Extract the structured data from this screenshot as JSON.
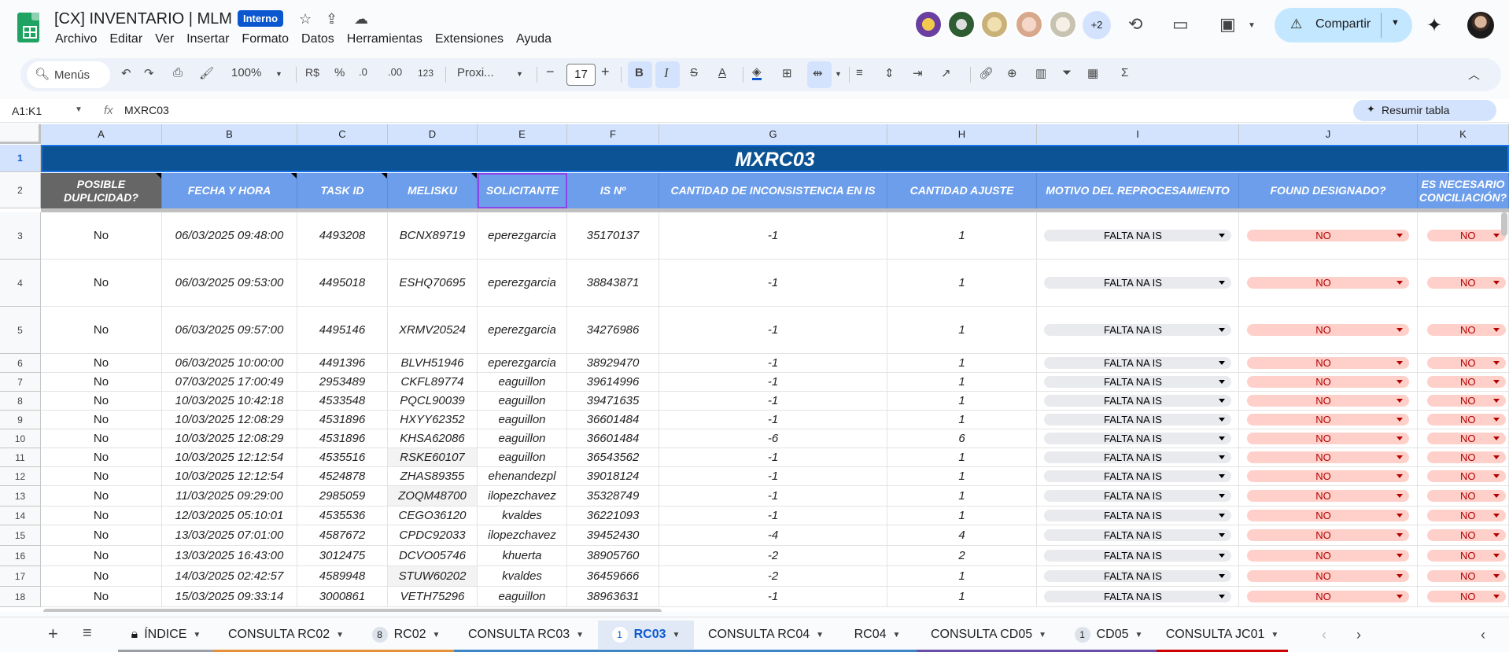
{
  "window": {
    "doc_title": "[CX] INVENTARIO | MLM",
    "badge": "Interno",
    "menu": [
      "Archivo",
      "Editar",
      "Ver",
      "Insertar",
      "Formato",
      "Datos",
      "Herramientas",
      "Extensiones",
      "Ayuda"
    ],
    "extra_collaborators": "+2",
    "share_label": "Compartir"
  },
  "toolbar": {
    "search_label": "Menús",
    "zoom": "100%",
    "currency": "R$",
    "percent": "%",
    "dec_decrease": ".0",
    "dec_increase": ".00",
    "number_format": "123",
    "font": "Proxi...",
    "font_size": "17"
  },
  "formula_bar": {
    "name_box": "A1:K1",
    "formula": "MXRC03",
    "summary_button": "Resumir tabla"
  },
  "grid": {
    "column_letters": [
      "A",
      "B",
      "C",
      "D",
      "E",
      "F",
      "G",
      "H",
      "I",
      "J",
      "K"
    ],
    "banner": "MXRC03",
    "headers": [
      "POSIBLE DUPLICIDAD?",
      "FECHA Y HORA",
      "TASK ID",
      "MELISKU",
      "SOLICITANTE",
      "IS Nº",
      "CANTIDAD DE INCONSISTENCIA EN IS",
      "CANTIDAD AJUSTE",
      "MOTIVO DEL REPROCESAMIENTO",
      "FOUND DESIGNADO?",
      "ES NECESARIO CONCILIACIÓN?"
    ],
    "row_numbers": [
      "1",
      "2",
      "3",
      "4",
      "5",
      "6",
      "7",
      "8",
      "9",
      "10",
      "11",
      "12",
      "13",
      "14",
      "15",
      "16",
      "17",
      "18"
    ],
    "rows": [
      [
        "No",
        "06/03/2025 09:48:00",
        "4493208",
        "BCNX89719",
        "eperezgarcia",
        "35170137",
        "-1",
        "1",
        "FALTA NA IS",
        "NO",
        "NO"
      ],
      [
        "No",
        "06/03/2025 09:53:00",
        "4495018",
        "ESHQ70695",
        "eperezgarcia",
        "38843871",
        "-1",
        "1",
        "FALTA NA IS",
        "NO",
        "NO"
      ],
      [
        "No",
        "06/03/2025 09:57:00",
        "4495146",
        "XRMV20524",
        "eperezgarcia",
        "34276986",
        "-1",
        "1",
        "FALTA NA IS",
        "NO",
        "NO"
      ],
      [
        "No",
        "06/03/2025 10:00:00",
        "4491396",
        "BLVH51946",
        "eperezgarcia",
        "38929470",
        "-1",
        "1",
        "FALTA NA IS",
        "NO",
        "NO"
      ],
      [
        "No",
        "07/03/2025 17:00:49",
        "2953489",
        "CKFL89774",
        "eaguillon",
        "39614996",
        "-1",
        "1",
        "FALTA NA IS",
        "NO",
        "NO"
      ],
      [
        "No",
        "10/03/2025 10:42:18",
        "4533548",
        "PQCL90039",
        "eaguillon",
        "39471635",
        "-1",
        "1",
        "FALTA NA IS",
        "NO",
        "NO"
      ],
      [
        "No",
        "10/03/2025 12:08:29",
        "4531896",
        "HXYY62352",
        "eaguillon",
        "36601484",
        "-1",
        "1",
        "FALTA NA IS",
        "NO",
        "NO"
      ],
      [
        "No",
        "10/03/2025 12:08:29",
        "4531896",
        "KHSA62086",
        "eaguillon",
        "36601484",
        "-6",
        "6",
        "FALTA NA IS",
        "NO",
        "NO"
      ],
      [
        "No",
        "10/03/2025 12:12:54",
        "4535516",
        "RSKE60107",
        "eaguillon",
        "36543562",
        "-1",
        "1",
        "FALTA NA IS",
        "NO",
        "NO"
      ],
      [
        "No",
        "10/03/2025 12:12:54",
        "4524878",
        "ZHAS89355",
        "ehenandezpl",
        "39018124",
        "-1",
        "1",
        "FALTA NA IS",
        "NO",
        "NO"
      ],
      [
        "No",
        "11/03/2025 09:29:00",
        "2985059",
        "ZOQM48700",
        "ilopezchavez",
        "35328749",
        "-1",
        "1",
        "FALTA NA IS",
        "NO",
        "NO"
      ],
      [
        "No",
        "12/03/2025 05:10:01",
        "4535536",
        "CEGO36120",
        "kvaldes",
        "36221093",
        "-1",
        "1",
        "FALTA NA IS",
        "NO",
        "NO"
      ],
      [
        "No",
        "13/03/2025 07:01:00",
        "4587672",
        "CPDC92033",
        "ilopezchavez",
        "39452430",
        "-4",
        "4",
        "FALTA NA IS",
        "NO",
        "NO"
      ],
      [
        "No",
        "13/03/2025 16:43:00",
        "3012475",
        "DCVO05746",
        "khuerta",
        "38905760",
        "-2",
        "2",
        "FALTA NA IS",
        "NO",
        "NO"
      ],
      [
        "No",
        "14/03/2025 02:42:57",
        "4589948",
        "STUW60202",
        "kvaldes",
        "36459666",
        "-2",
        "1",
        "FALTA NA IS",
        "NO",
        "NO"
      ],
      [
        "No",
        "15/03/2025 09:33:14",
        "3000861",
        "VETH75296",
        "eaguillon",
        "38963631",
        "-1",
        "1",
        "FALTA NA IS",
        "NO",
        "NO"
      ]
    ]
  },
  "tabs": [
    {
      "label": "ÍNDICE",
      "count": "",
      "locked": true,
      "color": "#9aa0a6",
      "active": false
    },
    {
      "label": "CONSULTA RC02",
      "count": "",
      "locked": false,
      "color": "#e69138",
      "active": false
    },
    {
      "label": "RC02",
      "count": "8",
      "locked": false,
      "color": "#e69138",
      "active": false
    },
    {
      "label": "CONSULTA RC03",
      "count": "",
      "locked": false,
      "color": "#3d85c6",
      "active": false
    },
    {
      "label": "RC03",
      "count": "1",
      "locked": false,
      "color": "#3d85c6",
      "active": true
    },
    {
      "label": "CONSULTA RC04",
      "count": "",
      "locked": false,
      "color": "#3d85c6",
      "active": false
    },
    {
      "label": "RC04",
      "count": "",
      "locked": false,
      "color": "#3d85c6",
      "active": false
    },
    {
      "label": "CONSULTA CD05",
      "count": "",
      "locked": false,
      "color": "#674ea7",
      "active": false
    },
    {
      "label": "CD05",
      "count": "1",
      "locked": false,
      "color": "#674ea7",
      "active": false
    },
    {
      "label": "CONSULTA JC01",
      "count": "",
      "locked": false,
      "color": "#cc0000",
      "active": false
    }
  ]
}
